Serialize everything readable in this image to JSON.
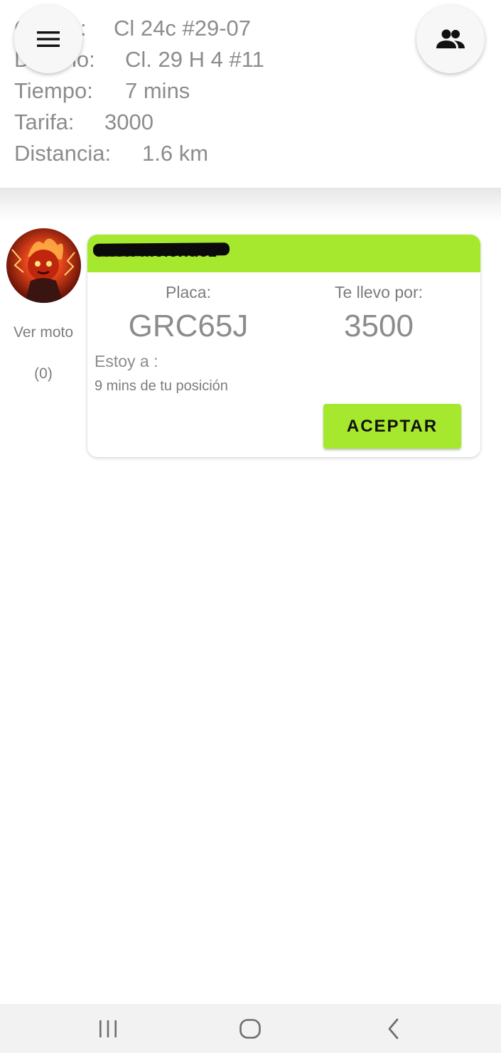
{
  "trip": {
    "origin_label": "Origen:",
    "origin_value": "Cl 24c #29-07",
    "destination_label": "Destino:",
    "destination_value": "Cl. 29 H 4 #11",
    "time_label": "Tiempo:",
    "time_value": "7 mins",
    "fare_label": "Tarifa:",
    "fare_value": "3000",
    "distance_label": "Distancia:",
    "distance_value": "1.6 km"
  },
  "header_buttons": {
    "menu_icon": "hamburger-menu-icon",
    "users_icon": "group-users-icon"
  },
  "offer": {
    "driver_name": "Jhon Melendez",
    "driver_name_redacted": true,
    "view_bike_label": "Ver moto",
    "rating": "(0)",
    "plate_label": "Placa:",
    "plate_value": "GRC65J",
    "price_label": "Te llevo por:",
    "price_value": "3500",
    "eta_label": "Estoy a :",
    "eta_value": "9 mins de tu posición",
    "accept_label": "ACEPTAR"
  },
  "colors": {
    "accent_green": "#a6e82d",
    "text_gray": "#8c8c8c",
    "navbar_bg": "#f2f2f2"
  },
  "system_nav": {
    "recent_icon": "recent-apps-icon",
    "home_icon": "home-icon",
    "back_icon": "back-icon"
  }
}
